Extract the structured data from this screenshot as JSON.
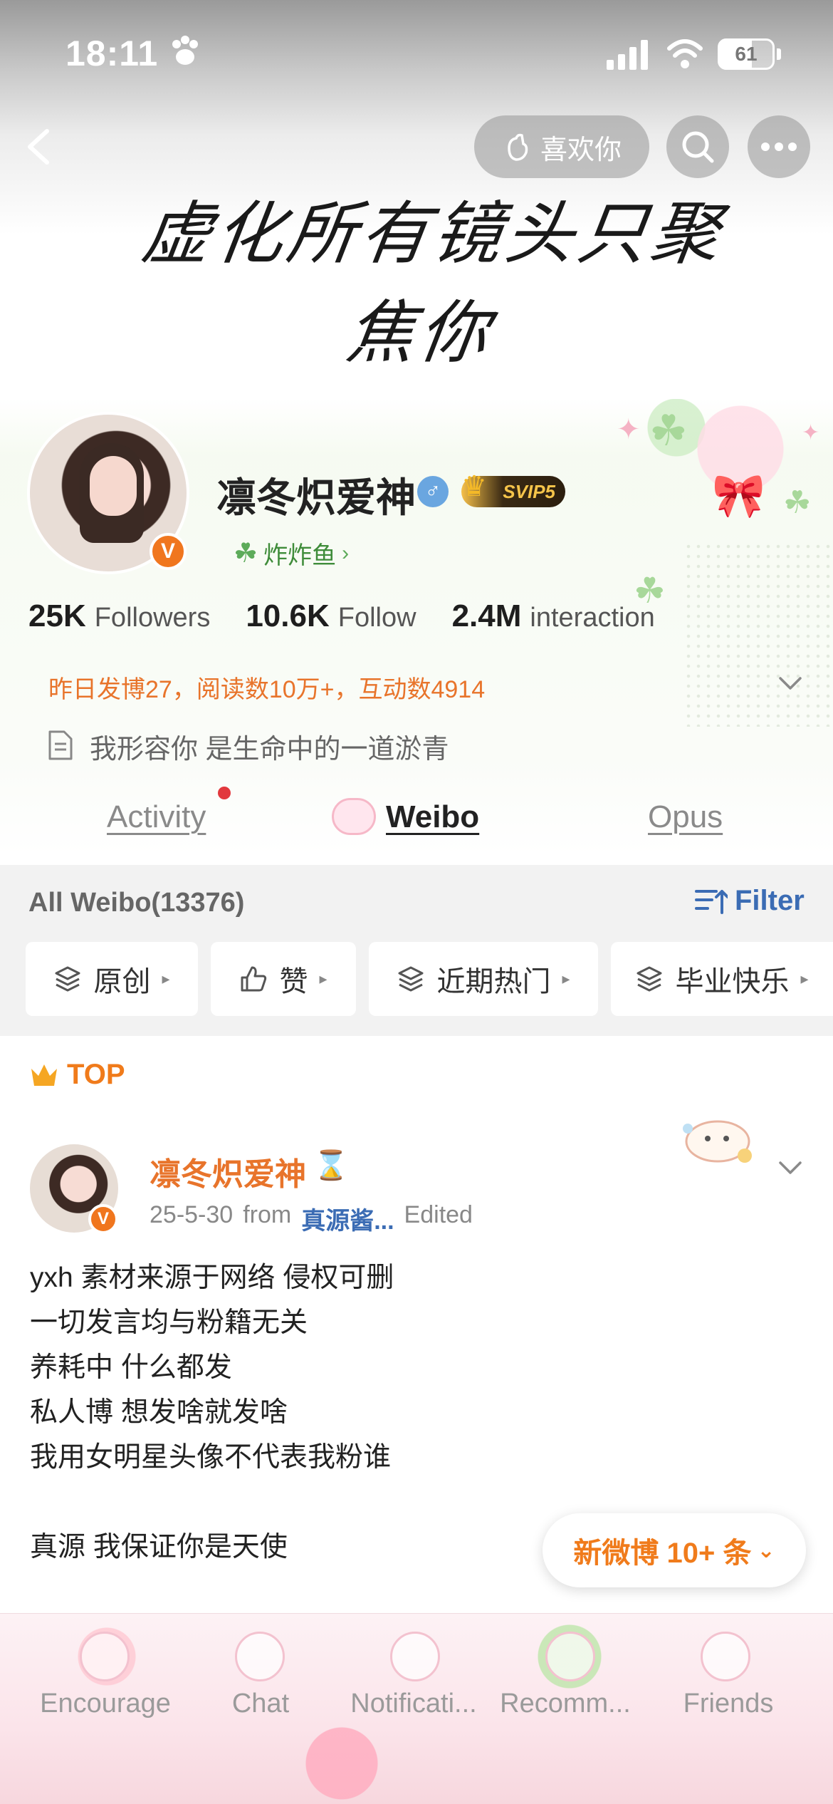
{
  "status_bar": {
    "time": "18:11",
    "battery": "61"
  },
  "header": {
    "like_label": "喜欢你",
    "slogan": "虚化所有镜头只聚焦你"
  },
  "profile": {
    "name": "凛冬炽爱神",
    "vip_badge": "SVIP5",
    "fan_group": "炸炸鱼",
    "stats": [
      {
        "value": "25K",
        "label": "Followers"
      },
      {
        "value": "10.6K",
        "label": "Follow"
      },
      {
        "value": "2.4M",
        "label": "interaction"
      }
    ],
    "yesterday_summary": "昨日发博27，阅读数10万+，互动数4914",
    "bio": "我形容你 是生命中的一道淤青"
  },
  "tabs": [
    {
      "label": "Activity",
      "active": false
    },
    {
      "label": "Weibo",
      "active": true
    },
    {
      "label": "Opus",
      "active": false
    }
  ],
  "filter_bar": {
    "all_weibo": "All Weibo(13376)",
    "filter_label": "Filter",
    "chips": [
      "原创",
      "赞",
      "近期热门",
      "毕业快乐"
    ]
  },
  "post": {
    "top_label": "TOP",
    "author": "凛冬炽爱神",
    "date": "25-5-30",
    "from_label": "from",
    "source": "真源酱...",
    "edited": "Edited",
    "lines": [
      "yxh 素材来源于网络 侵权可删",
      "一切发言均与粉籍无关",
      "养耗中 什么都发",
      "私人博 想发啥就发啥",
      "我用女明星头像不代表我粉谁",
      "",
      "真源 我保证你是天使"
    ]
  },
  "new_weibo": "新微博 10+ 条",
  "bottom_nav": [
    "Encourage",
    "Chat",
    "Notificati...",
    "Recomm...",
    "Friends"
  ],
  "colors": {
    "accent_orange": "#f07b1b",
    "link_blue": "#3b6cb4",
    "fan_green": "#3f8c3a",
    "verified_orange": "#f0761e"
  }
}
